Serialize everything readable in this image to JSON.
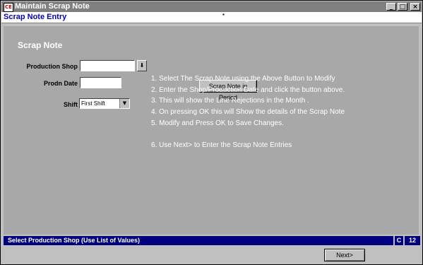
{
  "window": {
    "title": "Maintain Scrap Note",
    "app_icon_text": "CE"
  },
  "titlebar_buttons": {
    "minimize": "_",
    "maximize": "□",
    "close": "×"
  },
  "header": {
    "title": "Scrap Note Entry",
    "marker": "▪"
  },
  "form": {
    "section_title": "Scrap Note",
    "production_shop": {
      "label": "Production Shop",
      "value": "",
      "lov_icon": "list-of-values-icon",
      "lov_glyph": "⬇"
    },
    "prodn_date": {
      "label": "Prodn Date",
      "value": ""
    },
    "shift": {
      "label": "Shift",
      "value": "First Shift",
      "arrow": "▼"
    },
    "scrap_note_button": "Scrap Note in Period"
  },
  "instructions": [
    "1. Select The Scrap Note using the Above Button to Modify",
    "2. Enter the Shop/Production Date and click the button above.",
    "3. This will show the Line Rejections in the Month .",
    "4. On pressing OK this will Show the details of the Scrap Note",
    "5. Modify and Press OK to Save Changes.",
    "6. Use Next> to Enter the Scrap Note Entries"
  ],
  "status": {
    "message": "Select Production Shop (Use List of Values)",
    "mode": "C",
    "count": "12"
  },
  "footer": {
    "next_button": "Next>"
  },
  "colors": {
    "title_bar": "#808080",
    "panel": "#a8a8a8",
    "status_bar": "#000080",
    "header_text": "#0000c0"
  }
}
